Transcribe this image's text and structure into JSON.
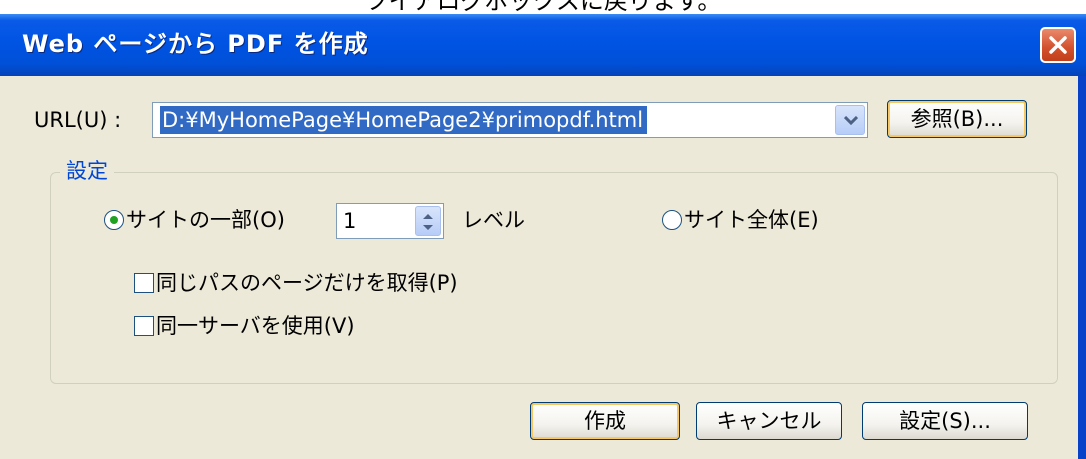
{
  "caption": "ツイアログボックスに戻ります。",
  "dialog": {
    "title": "Web ページから PDF を作成",
    "close_icon": "close-x-icon"
  },
  "url": {
    "label": "URL(U) :",
    "value": "D:¥MyHomePage¥HomePage2¥primopdf.html",
    "browse_label": "参照(B)..."
  },
  "settings": {
    "legend": "設定",
    "radio_part_label": "サイトの一部(O)",
    "radio_part_selected": true,
    "levels_value": "1",
    "levels_label": "レベル",
    "radio_whole_label": "サイト全体(E)",
    "radio_whole_selected": false,
    "checkbox_same_path_label": "同じパスのページだけを取得(P)",
    "checkbox_same_path_checked": false,
    "checkbox_same_server_label": "同一サーバを使用(V)",
    "checkbox_same_server_checked": false
  },
  "buttons": {
    "create": "作成",
    "cancel": "キャンセル",
    "settings": "設定(S)..."
  },
  "colors": {
    "titlebar": "#0054e3",
    "selection": "#316ac5",
    "legend": "#0046d5",
    "radio_dot": "#21a121"
  }
}
